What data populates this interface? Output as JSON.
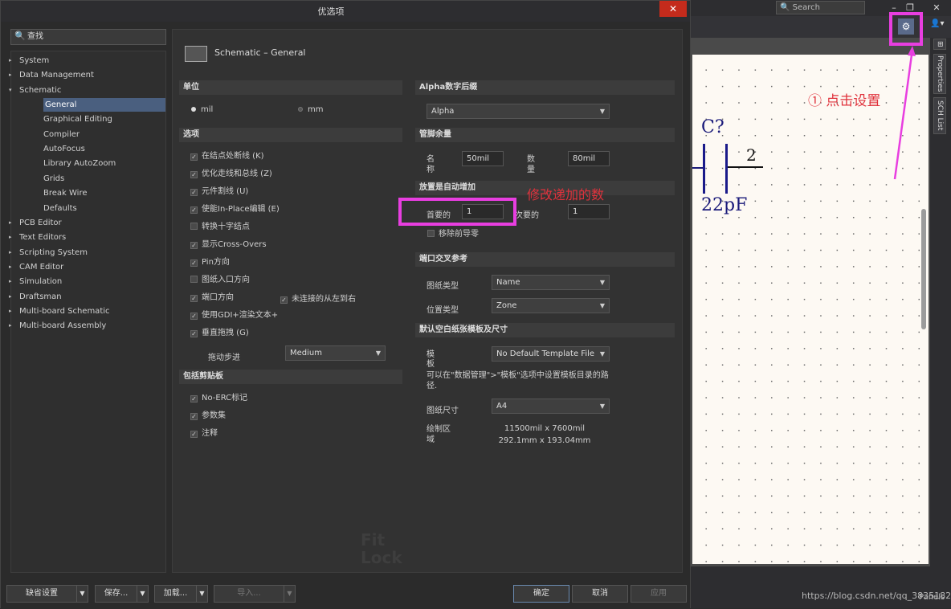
{
  "dialog": {
    "title": "优选项",
    "close_glyph": "✕",
    "search_placeholder": "查找",
    "tree": [
      {
        "label": "System",
        "arrow": "▸"
      },
      {
        "label": "Data Management",
        "arrow": "▸"
      },
      {
        "label": "Schematic",
        "arrow": "▾"
      },
      {
        "label": "General",
        "selected": true
      },
      {
        "label": "Graphical Editing"
      },
      {
        "label": "Compiler"
      },
      {
        "label": "AutoFocus"
      },
      {
        "label": "Library AutoZoom"
      },
      {
        "label": "Grids"
      },
      {
        "label": "Break Wire"
      },
      {
        "label": "Defaults"
      },
      {
        "label": "PCB Editor",
        "arrow": "▸"
      },
      {
        "label": "Text Editors",
        "arrow": "▸"
      },
      {
        "label": "Scripting System",
        "arrow": "▸"
      },
      {
        "label": "CAM Editor",
        "arrow": "▸"
      },
      {
        "label": "Simulation",
        "arrow": "▸"
      },
      {
        "label": "Draftsman",
        "arrow": "▸"
      },
      {
        "label": "Multi-board Schematic",
        "arrow": "▸"
      },
      {
        "label": "Multi-board Assembly",
        "arrow": "▸"
      }
    ],
    "page_title": "Schematic – General",
    "units": {
      "header": "单位",
      "mil": "mil",
      "mm": "mm",
      "selected": "mil"
    },
    "options": {
      "header": "选项",
      "items": [
        {
          "label": "在结点处断线 (K)",
          "checked": true
        },
        {
          "label": "优化走线和总线 (Z)",
          "checked": true
        },
        {
          "label": "元件割线 (U)",
          "checked": true
        },
        {
          "label": "使能In-Place编辑 (E)",
          "checked": true
        },
        {
          "label": "转换十字结点",
          "checked": false
        },
        {
          "label": "显示Cross-Overs",
          "checked": true
        },
        {
          "label": "Pin方向",
          "checked": true
        },
        {
          "label": "图纸入口方向",
          "checked": false
        },
        {
          "label": "端口方向",
          "checked": true
        },
        {
          "label": "使用GDI+渲染文本+",
          "checked": true
        },
        {
          "label": "垂直拖拽 (G)",
          "checked": true
        }
      ],
      "unconnected_left_right": {
        "label": "未连接的从左到右",
        "checked": true
      },
      "drag_step_label": "拖动步进",
      "drag_step_value": "Medium"
    },
    "clipboard": {
      "header": "包括剪贴板",
      "items": [
        {
          "label": "No-ERC标记",
          "checked": true
        },
        {
          "label": "参数集",
          "checked": true
        },
        {
          "label": "注释",
          "checked": true
        }
      ]
    },
    "alpha_suffix": {
      "header": "Alpha数字后缀",
      "value": "Alpha"
    },
    "pin_margin": {
      "header": "管脚余量",
      "name_label": "名称",
      "name_value": "50mil",
      "number_label": "数量",
      "number_value": "80mil"
    },
    "auto_increment": {
      "header": "放置是自动增加",
      "primary_label": "首要的",
      "primary_value": "1",
      "secondary_label": "次要的",
      "secondary_value": "1",
      "remove_leading_zeros": "移除前导零"
    },
    "port_cross_ref": {
      "header": "端口交叉参考",
      "sheet_type_label": "图纸类型",
      "sheet_type_value": "Name",
      "location_type_label": "位置类型",
      "location_type_value": "Zone"
    },
    "default_template": {
      "header": "默认空白纸张模板及尺寸",
      "template_label": "模板",
      "template_value": "No Default Template File",
      "hint": "可以在\"数据管理\">\"模板\"选项中设置模板目录的路径.",
      "sheet_size_label": "图纸尺寸",
      "sheet_size_value": "A4",
      "draw_area_label": "绘制区域",
      "draw_area_mil": "11500mil x 7600mil",
      "draw_area_mm": "292.1mm x 193.04mm"
    },
    "watermark": "Fit\nLock",
    "footer": {
      "defaults": "缺省设置",
      "save": "保存...",
      "load": "加载...",
      "import": "导入...",
      "ok": "确定",
      "cancel": "取消",
      "apply": "应用"
    }
  },
  "annotations": {
    "step1": "① 点击设置",
    "modify_increment": "修改递加的数"
  },
  "background_app": {
    "search": "Search",
    "panels_tabs": [
      "Properties",
      "SCH List"
    ],
    "cap_ref": "C?",
    "cap_value": "22pF",
    "pin_number": "2",
    "panels_button": "Panels",
    "csdn_watermark": "https://blog.csdn.net/qq_38351824"
  },
  "colors": {
    "highlight": "#e83ee0",
    "annotation": "#e0323c",
    "selection": "#4a5f7f",
    "close": "#c42b1c"
  }
}
